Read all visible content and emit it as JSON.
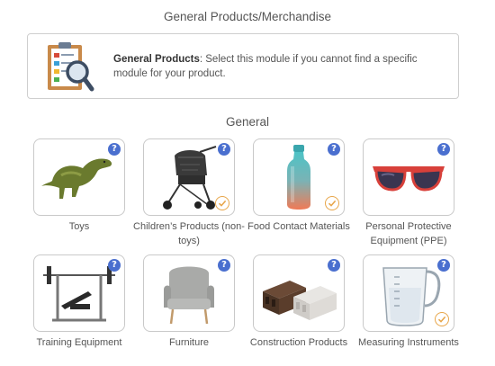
{
  "page": {
    "title": "General Products/Merchandise"
  },
  "info_card": {
    "bold": "General Products",
    "text": ": Select this module if you cannot find a specific module for your product.",
    "illustration_icon": "clipboard-magnifier-icon"
  },
  "section": {
    "title": "General"
  },
  "help_glyph": "?",
  "colors": {
    "help": "#4a6fcf",
    "check": "#e8a64a",
    "border": "#c9c9c9"
  },
  "products": [
    {
      "label": "Toys",
      "icon": "dinosaur-toy-icon",
      "selected": false
    },
    {
      "label": "Children’s Products (non-toys)",
      "icon": "stroller-icon",
      "selected": true
    },
    {
      "label": "Food Contact Materials",
      "icon": "water-bottle-icon",
      "selected": true
    },
    {
      "label": "Personal Protective Equipment (PPE)",
      "icon": "sunglasses-icon",
      "selected": false
    },
    {
      "label": "Training Equipment",
      "icon": "weight-bench-icon",
      "selected": false
    },
    {
      "label": "Furniture",
      "icon": "armchair-icon",
      "selected": false
    },
    {
      "label": "Construction Products",
      "icon": "composite-beams-icon",
      "selected": false
    },
    {
      "label": "Measuring Instruments",
      "icon": "measuring-jug-icon",
      "selected": true
    }
  ]
}
